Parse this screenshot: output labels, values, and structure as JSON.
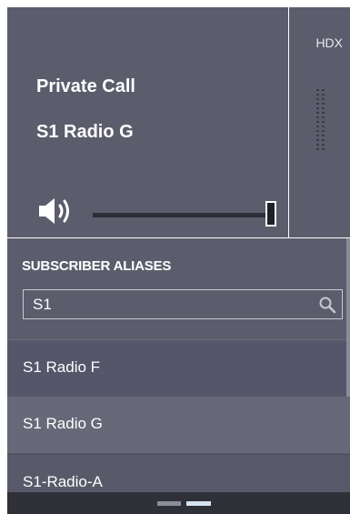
{
  "call": {
    "type_label": "Private Call",
    "target_label": "S1 Radio G"
  },
  "hdx": {
    "label": "HDX"
  },
  "volume": {
    "level": 1.0
  },
  "aliases": {
    "header": "SUBSCRIBER ALIASES",
    "search_value": "S1",
    "results": [
      {
        "label": "S1 Radio F"
      },
      {
        "label": "S1 Radio G"
      },
      {
        "label": "S1-Radio-A"
      }
    ]
  },
  "pager": {
    "pages": 2,
    "active_page": 2
  },
  "colors": {
    "panel": "#5c5d6c",
    "selected_row": "#676878",
    "active_dot": "#d6e3f2"
  },
  "icons": {
    "speaker": "speaker-icon",
    "search": "search-icon",
    "ptt_handle": "grip-icon"
  }
}
